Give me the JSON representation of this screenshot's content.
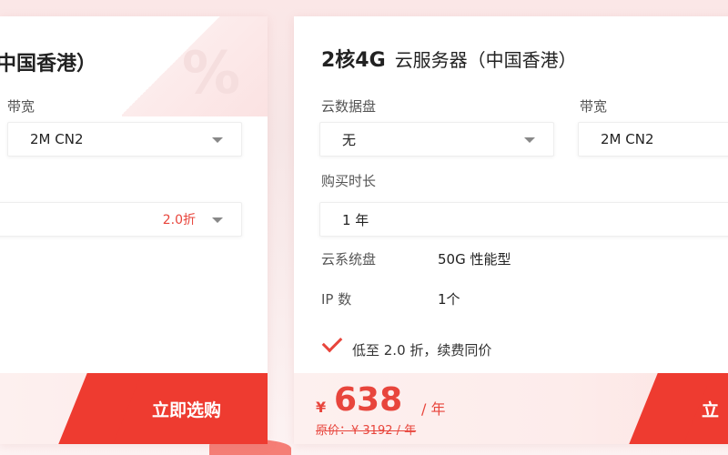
{
  "left_card": {
    "title_fragment": "中国香港）",
    "bandwidth_label": "带宽",
    "bandwidth_value": "2M CN2",
    "duration_discount": "2.0折",
    "buy_button": "立即选购"
  },
  "right_card": {
    "title_main": "2核4G",
    "title_sub": "云服务器（中国香港）",
    "data_disk_label": "云数据盘",
    "data_disk_value": "无",
    "bandwidth_label": "带宽",
    "bandwidth_value": "2M CN2",
    "duration_label": "购买时长",
    "duration_value": "1 年",
    "system_disk_label": "云系统盘",
    "system_disk_value": "50G 性能型",
    "ip_label": "IP 数",
    "ip_value": "1个",
    "promo_text": "低至 2.0 折，续费同价",
    "price_currency": "¥",
    "price_value": "638",
    "price_unit": "/ 年",
    "original_price": "原价：¥ 3192 / 年",
    "buy_button_fragment": "立"
  },
  "colors": {
    "accent": "#ee3b30",
    "price": "#e8453c",
    "background": "#f8eaea"
  }
}
